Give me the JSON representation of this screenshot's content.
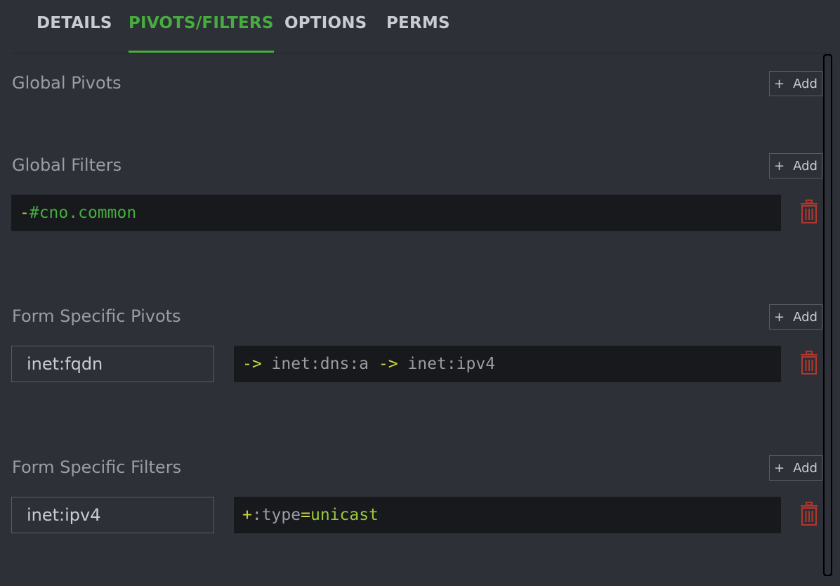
{
  "tabs": [
    {
      "label": "DETAILS",
      "active": false
    },
    {
      "label": "PIVOTS/FILTERS",
      "active": true
    },
    {
      "label": "OPTIONS",
      "active": false
    },
    {
      "label": "PERMS",
      "active": false
    }
  ],
  "accent_color": "#46ad3e",
  "delete_color": "#b3362c",
  "sections": {
    "global_pivots": {
      "title": "Global Pivots",
      "add_label": "Add"
    },
    "global_filters": {
      "title": "Global Filters",
      "add_label": "Add",
      "items": [
        {
          "query": {
            "op": "-",
            "tag": "#cno.common"
          }
        }
      ]
    },
    "form_pivots": {
      "title": "Form Specific Pivots",
      "add_label": "Add",
      "items": [
        {
          "form": "inet:fqdn",
          "query": {
            "op1": "->",
            "t1": " inet:dns:a ",
            "op2": "->",
            "t2": " inet:ipv4"
          }
        }
      ]
    },
    "form_filters": {
      "title": "Form Specific Filters",
      "add_label": "Add",
      "items": [
        {
          "form": "inet:ipv4",
          "query": {
            "op": "+",
            "prop": ":type",
            "eq": "=",
            "val": "unicast"
          }
        }
      ]
    }
  },
  "icons": {
    "add": "plus-icon",
    "delete": "trash-icon"
  }
}
